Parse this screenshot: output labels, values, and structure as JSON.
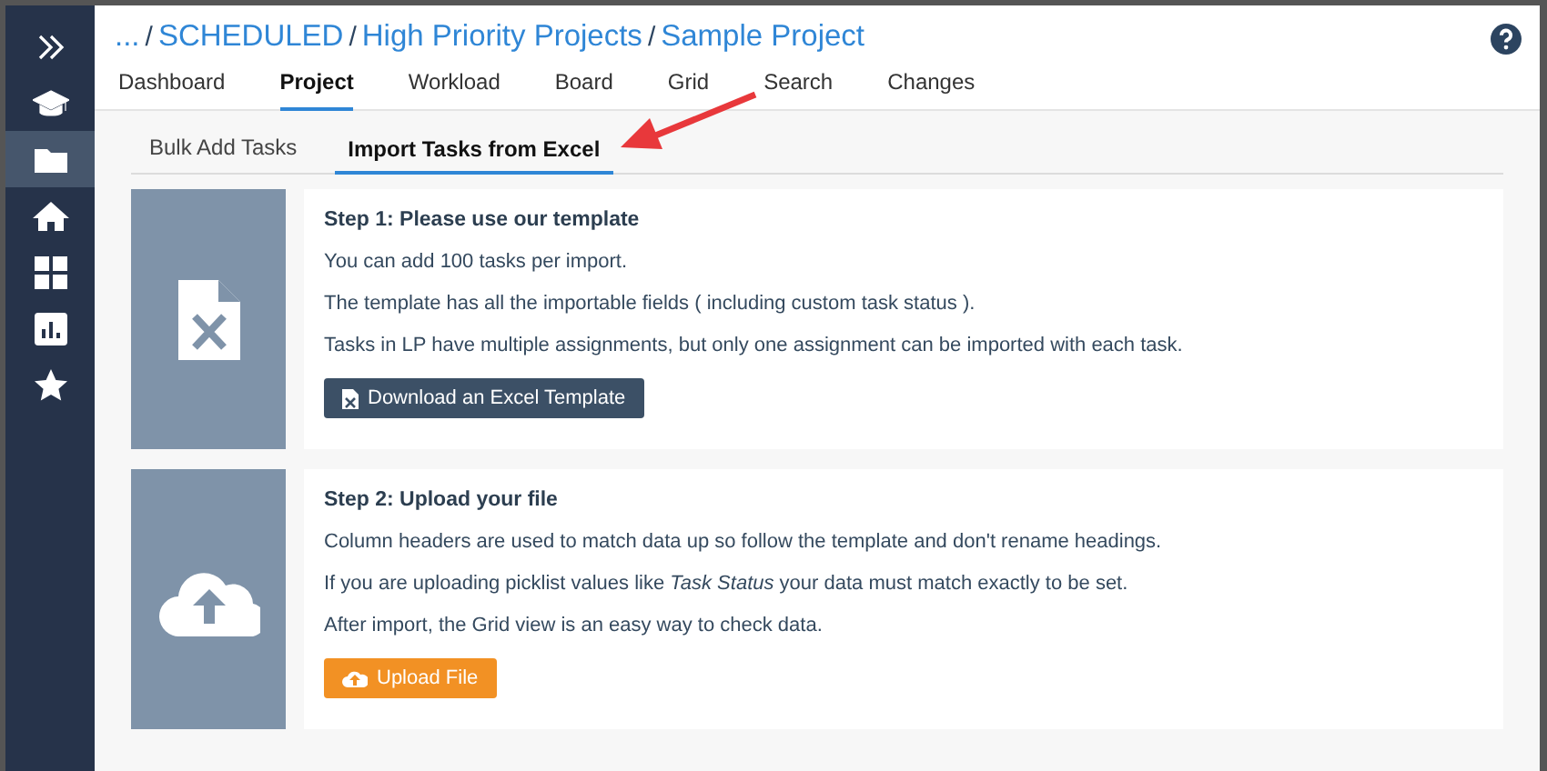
{
  "sidebar": {
    "items": [
      {
        "kind": "chevrons",
        "selected": false
      },
      {
        "kind": "cap",
        "selected": false
      },
      {
        "kind": "folder",
        "selected": true
      },
      {
        "kind": "home",
        "selected": false
      },
      {
        "kind": "grid",
        "selected": false
      },
      {
        "kind": "chart",
        "selected": false
      },
      {
        "kind": "star",
        "selected": false
      }
    ]
  },
  "breadcrumb": {
    "separator": "/",
    "items": [
      "...",
      "SCHEDULED",
      "High Priority Projects",
      "Sample Project"
    ]
  },
  "nav_tabs": [
    {
      "label": "Dashboard",
      "selected": false
    },
    {
      "label": "Project",
      "selected": true
    },
    {
      "label": "Workload",
      "selected": false
    },
    {
      "label": "Board",
      "selected": false
    },
    {
      "label": "Grid",
      "selected": false
    },
    {
      "label": "Search",
      "selected": false
    },
    {
      "label": "Changes",
      "selected": false
    }
  ],
  "sub_tabs": [
    {
      "label": "Bulk Add Tasks",
      "selected": false
    },
    {
      "label": "Import Tasks from Excel",
      "selected": true
    }
  ],
  "steps": [
    {
      "kind": "excel",
      "title": "Step 1: Please use our template",
      "lines": [
        "You can add 100 tasks per import.",
        "The template has all the importable fields ( including custom task status ).",
        "Tasks in LP have multiple assignments, but only one assignment can be imported with each task."
      ],
      "button": {
        "kind": "download",
        "label": "Download an Excel Template"
      }
    },
    {
      "kind": "upload",
      "title": "Step 2: Upload your file",
      "lines": [
        "Column headers are used to match data up so follow the template and don't rename headings.",
        "If you are uploading picklist values like *Task Status* your data must match exactly to be set.",
        "After import, the Grid view is an easy way to check data."
      ],
      "button": {
        "kind": "upload",
        "label": "Upload File"
      }
    }
  ]
}
